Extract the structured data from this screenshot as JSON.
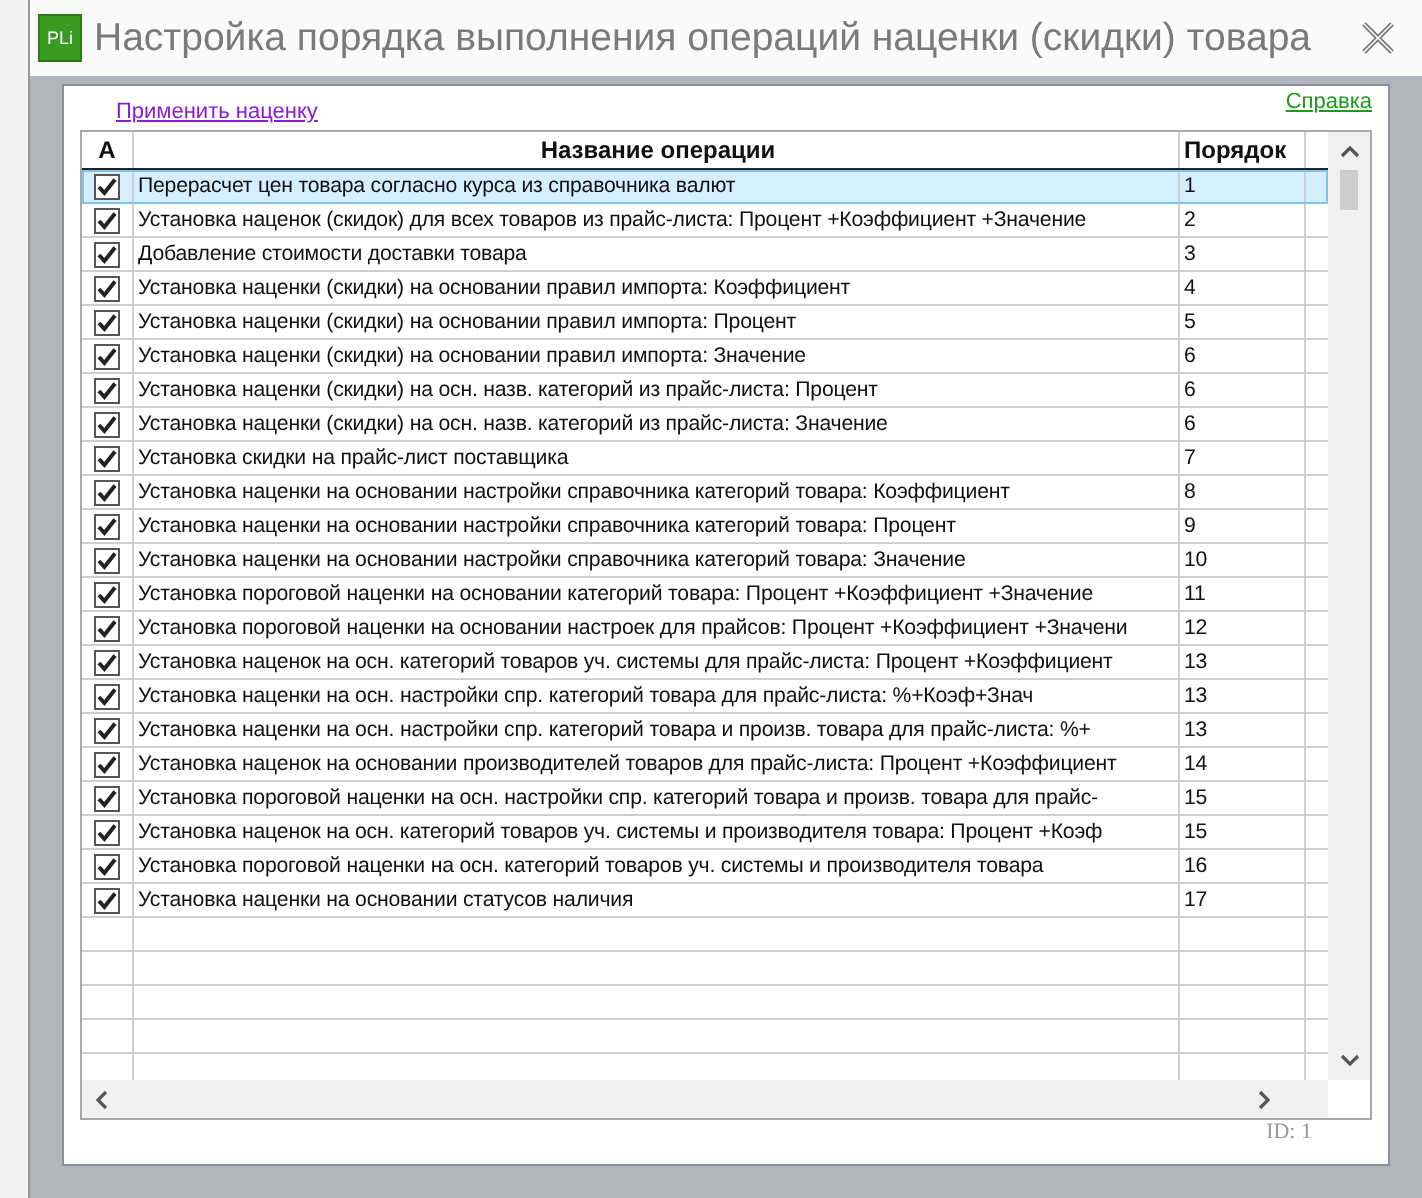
{
  "window": {
    "title": "Настройка порядка выполнения операций наценки (скидки) товара",
    "icon_text": "PLi"
  },
  "apply_link": "Применить наценку",
  "help_link": "Справка",
  "table": {
    "columns": [
      "А",
      "Название операции",
      "Порядок"
    ],
    "rows": [
      {
        "checked": true,
        "selected": true,
        "name": "Перерасчет цен товара согласно курса из справочника валют",
        "order": "1"
      },
      {
        "checked": true,
        "selected": false,
        "name": "Установка наценок (скидок) для всех товаров из прайс-листа: Процент +Коэффициент +Значение",
        "order": "2"
      },
      {
        "checked": true,
        "selected": false,
        "name": "Добавление стоимости доставки товара",
        "order": "3"
      },
      {
        "checked": true,
        "selected": false,
        "name": "Установка наценки (скидки) на основании правил импорта: Коэффициент",
        "order": "4"
      },
      {
        "checked": true,
        "selected": false,
        "name": "Установка наценки (скидки) на основании правил импорта: Процент",
        "order": "5"
      },
      {
        "checked": true,
        "selected": false,
        "name": "Установка наценки (скидки) на основании правил импорта: Значение",
        "order": "6"
      },
      {
        "checked": true,
        "selected": false,
        "name": "Установка наценки (скидки) на осн. назв. категорий из прайс-листа: Процент",
        "order": "6"
      },
      {
        "checked": true,
        "selected": false,
        "name": "Установка наценки (скидки) на осн. назв. категорий из прайс-листа: Значение",
        "order": "6"
      },
      {
        "checked": true,
        "selected": false,
        "name": "Установка скидки на прайс-лист поставщика",
        "order": "7"
      },
      {
        "checked": true,
        "selected": false,
        "name": "Установка наценки на основании настройки справочника категорий товара: Коэффициент",
        "order": "8"
      },
      {
        "checked": true,
        "selected": false,
        "name": "Установка наценки на основании настройки справочника категорий товара: Процент",
        "order": "9"
      },
      {
        "checked": true,
        "selected": false,
        "name": "Установка наценки на основании настройки справочника категорий товара: Значение",
        "order": "10"
      },
      {
        "checked": true,
        "selected": false,
        "name": "Установка пороговой наценки на основании категорий товара: Процент +Коэффициент +Значение",
        "order": "11"
      },
      {
        "checked": true,
        "selected": false,
        "name": "Установка пороговой наценки на основании настроек для прайсов: Процент +Коэффициент +Значени",
        "order": "12"
      },
      {
        "checked": true,
        "selected": false,
        "name": "Установка наценок на осн. категорий товаров уч. системы для прайс-листа: Процент +Коэффициент",
        "order": "13"
      },
      {
        "checked": true,
        "selected": false,
        "name": "Установка наценки на осн. настройки спр. категорий товара для прайс-листа: %+Коэф+Знач",
        "order": "13"
      },
      {
        "checked": true,
        "selected": false,
        "name": "Установка наценки на осн. настройки спр. категорий товара и произв. товара для прайс-листа: %+",
        "order": "13"
      },
      {
        "checked": true,
        "selected": false,
        "name": "Установка наценок на основании производителей товаров для прайс-листа: Процент +Коэффициент",
        "order": "14"
      },
      {
        "checked": true,
        "selected": false,
        "name": "Установка пороговой наценки на осн. настройки спр. категорий товара и произв. товара для прайс-",
        "order": "15"
      },
      {
        "checked": true,
        "selected": false,
        "name": "Установка наценок на осн. категорий товаров уч. системы и производителя товара: Процент +Коэф",
        "order": "15"
      },
      {
        "checked": true,
        "selected": false,
        "name": "Установка пороговой наценки на осн. категорий товаров уч. системы и производителя товара",
        "order": "16"
      },
      {
        "checked": true,
        "selected": false,
        "name": "Установка наценки на основании статусов наличия",
        "order": "17"
      }
    ]
  },
  "id_label": "ID: 1"
}
